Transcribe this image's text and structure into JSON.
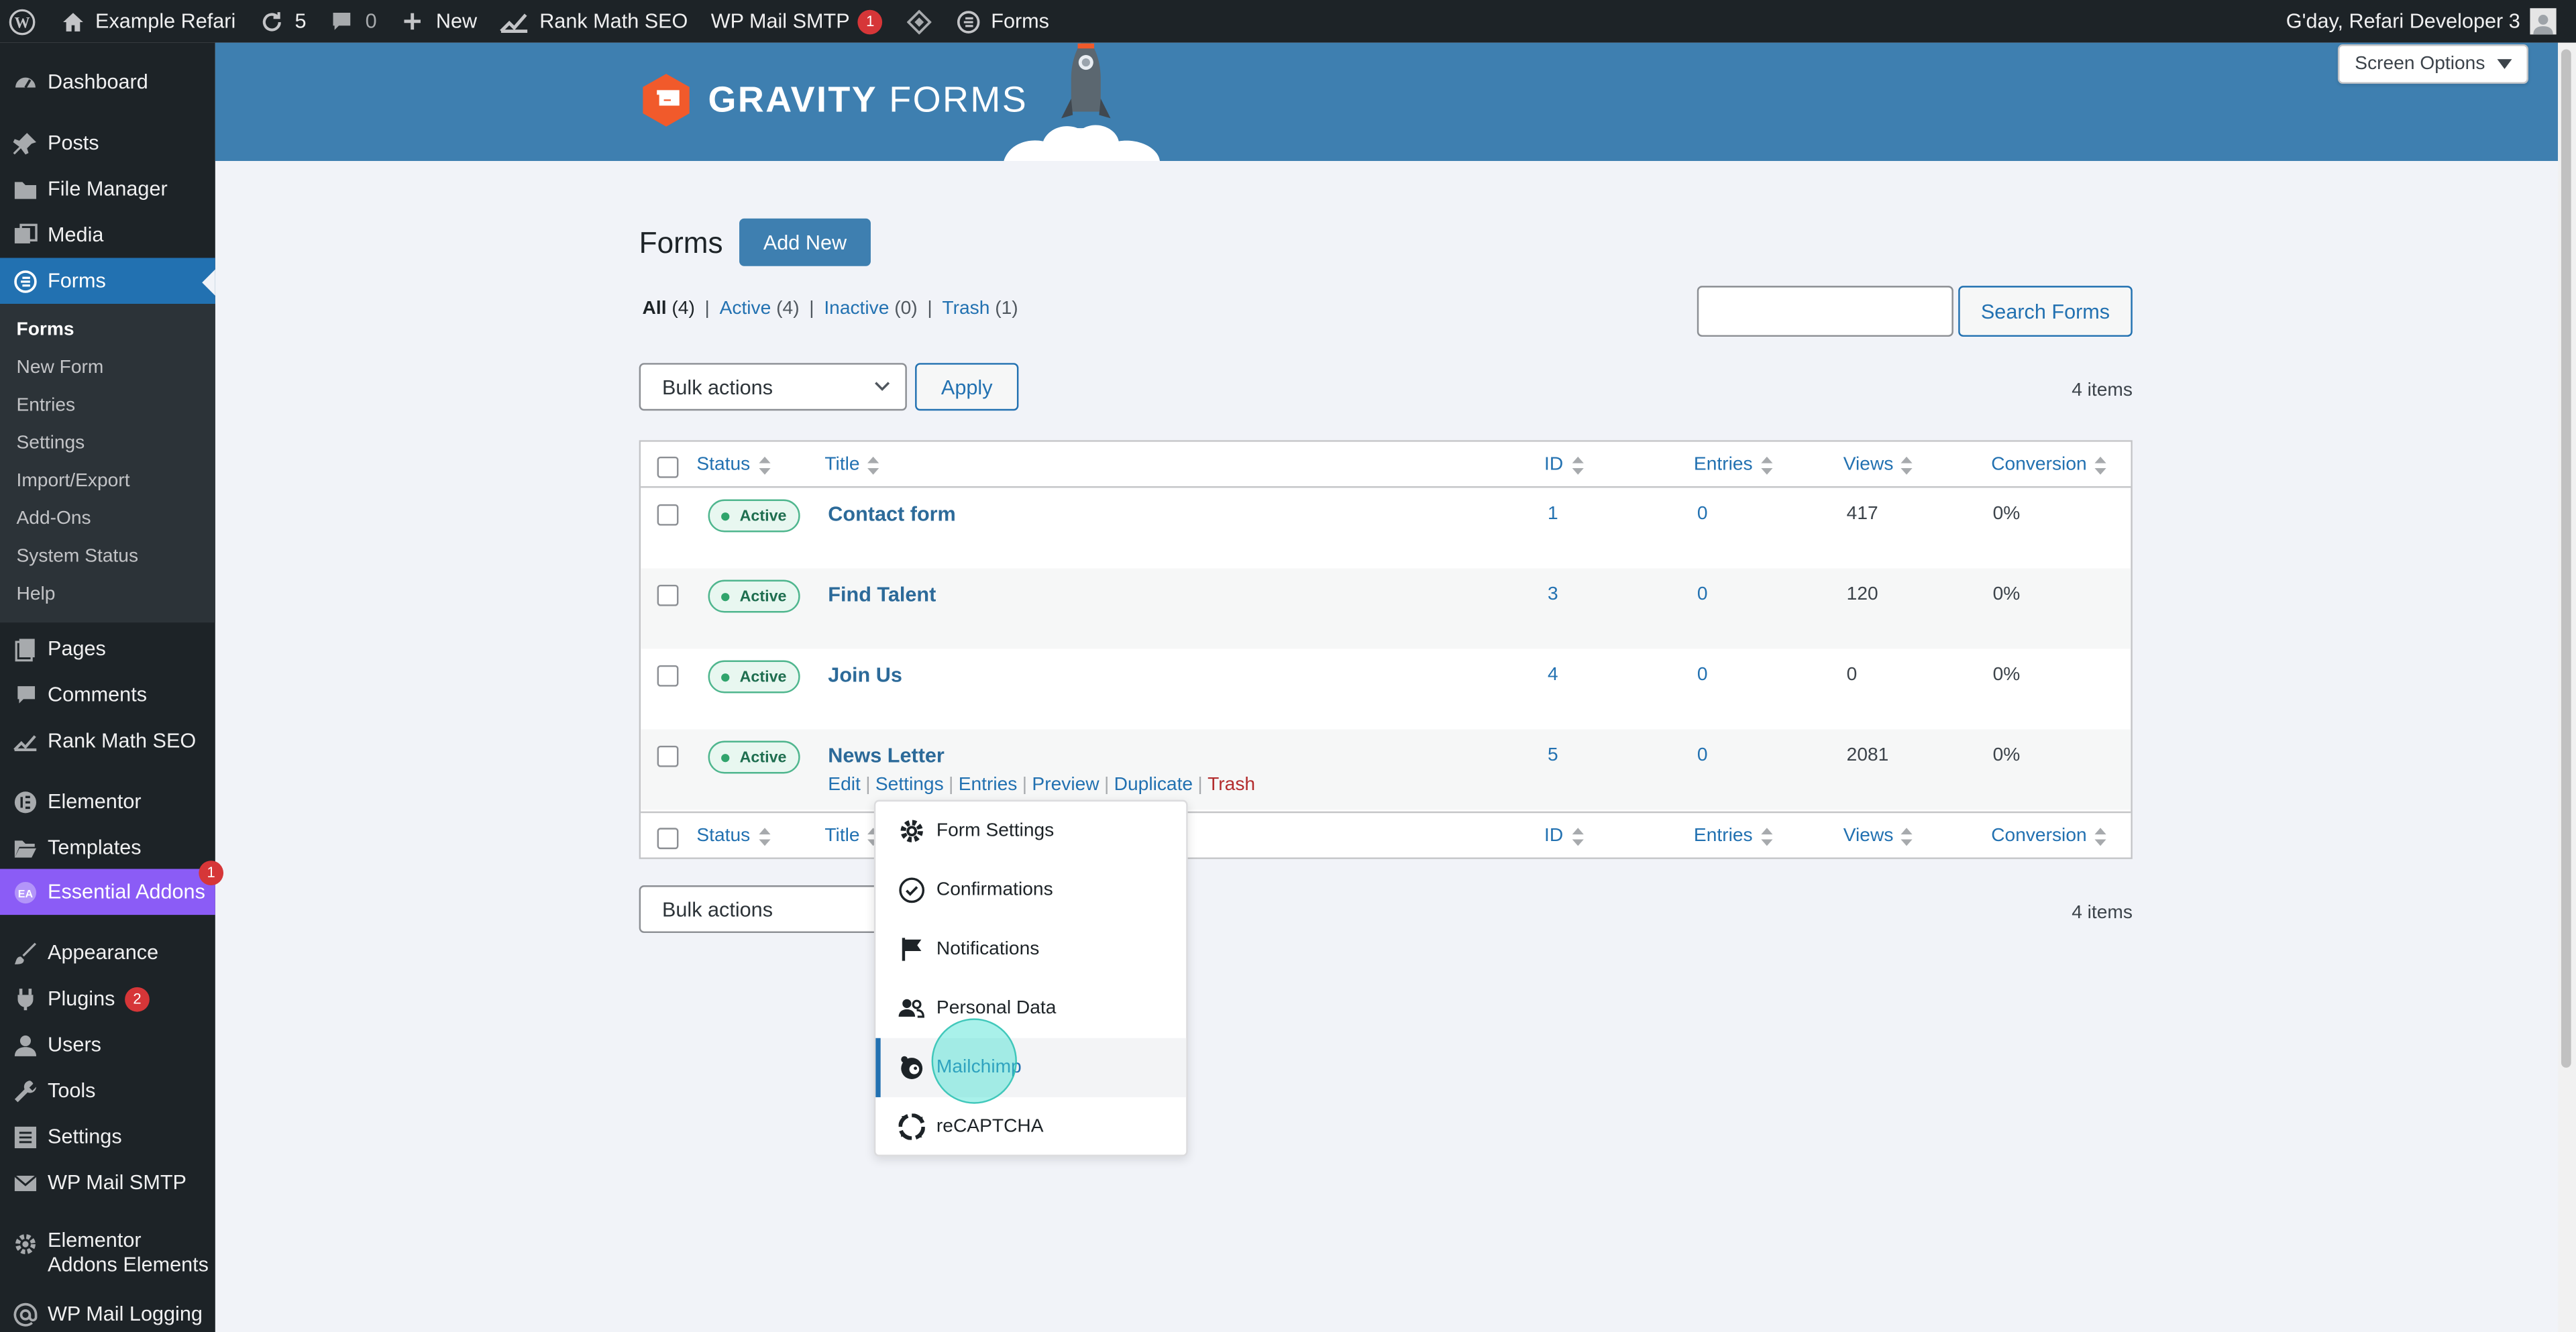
{
  "adminbar": {
    "site_name": "Example Refari",
    "updates_count": "5",
    "comments_count": "0",
    "new_label": "New",
    "rankmath_label": "Rank Math SEO",
    "smtp_label": "WP Mail SMTP",
    "smtp_badge": "1",
    "forms_label": "Forms",
    "greeting": "G'day, Refari Developer 3"
  },
  "sidebar": {
    "dashboard": "Dashboard",
    "posts": "Posts",
    "file_manager": "File Manager",
    "media": "Media",
    "forms": "Forms",
    "submenu": [
      "Forms",
      "New Form",
      "Entries",
      "Settings",
      "Import/Export",
      "Add-Ons",
      "System Status",
      "Help"
    ],
    "pages": "Pages",
    "comments": "Comments",
    "rankmath": "Rank Math SEO",
    "elementor": "Elementor",
    "templates": "Templates",
    "essential_addons": "Essential Addons",
    "essential_addons_badge": "1",
    "appearance": "Appearance",
    "plugins": "Plugins",
    "plugins_badge": "2",
    "users": "Users",
    "tools": "Tools",
    "settings": "Settings",
    "wp_mail_smtp": "WP Mail SMTP",
    "elementor_addons_line1": "Elementor",
    "elementor_addons_line2": "Addons Elements",
    "wp_mail_logging": "WP Mail Logging"
  },
  "header": {
    "logo_bold": "GRAVITY",
    "logo_light": "FORMS",
    "screen_options": "Screen Options"
  },
  "main": {
    "title": "Forms",
    "add_new": "Add New",
    "filters": {
      "all": "All",
      "all_count": "(4)",
      "active": "Active",
      "active_count": "(4)",
      "inactive": "Inactive",
      "inactive_count": "(0)",
      "trash": "Trash",
      "trash_count": "(1)"
    },
    "search_button": "Search Forms",
    "bulk_actions": "Bulk actions",
    "apply": "Apply",
    "items_count": "4 items"
  },
  "table": {
    "columns": [
      "Status",
      "Title",
      "ID",
      "Entries",
      "Views",
      "Conversion"
    ],
    "rows": [
      {
        "status": "Active",
        "title": "Contact form",
        "id": "1",
        "entries": "0",
        "views": "417",
        "conversion": "0%"
      },
      {
        "status": "Active",
        "title": "Find Talent",
        "id": "3",
        "entries": "0",
        "views": "120",
        "conversion": "0%"
      },
      {
        "status": "Active",
        "title": "Join Us",
        "id": "4",
        "entries": "0",
        "views": "0",
        "conversion": "0%"
      },
      {
        "status": "Active",
        "title": "News Letter",
        "id": "5",
        "entries": "0",
        "views": "2081",
        "conversion": "0%"
      }
    ],
    "row_actions": [
      "Edit",
      "Settings",
      "Entries",
      "Preview",
      "Duplicate",
      "Trash"
    ]
  },
  "settings_menu": {
    "items": [
      "Form Settings",
      "Confirmations",
      "Notifications",
      "Personal Data",
      "Mailchimp",
      "reCAPTCHA"
    ],
    "highlighted": "Mailchimp"
  },
  "colors": {
    "accent": "#2271b1",
    "header_blue": "#3e7fb0",
    "admin_dark": "#1d2327",
    "active_badge": "#30a46c",
    "essential_addons": "#8b5cf6"
  }
}
